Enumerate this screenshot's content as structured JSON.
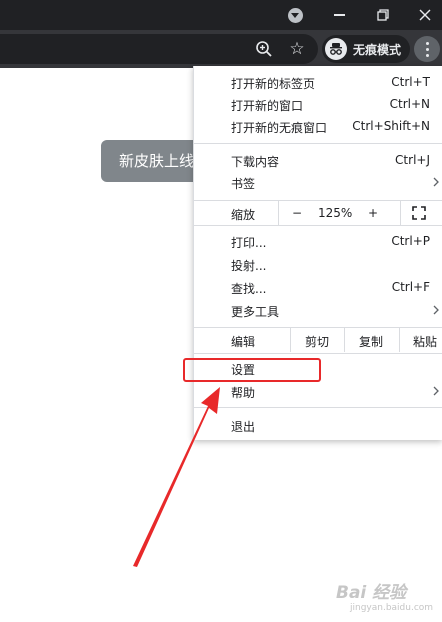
{
  "browser": {
    "incognito_label": "无痕模式"
  },
  "page": {
    "toast_text": "新皮肤上线"
  },
  "menu": {
    "items_top": [
      {
        "label": "打开新的标签页",
        "shortcut": "Ctrl+T"
      },
      {
        "label": "打开新的窗口",
        "shortcut": "Ctrl+N"
      },
      {
        "label": "打开新的无痕窗口",
        "shortcut": "Ctrl+Shift+N"
      }
    ],
    "items_downloads": [
      {
        "label": "下载内容",
        "shortcut": "Ctrl+J"
      },
      {
        "label": "书签",
        "shortcut": ""
      }
    ],
    "zoom": {
      "label": "缩放",
      "minus": "−",
      "value": "125%",
      "plus": "+"
    },
    "items_tools": [
      {
        "label": "打印...",
        "shortcut": "Ctrl+P"
      },
      {
        "label": "投射...",
        "shortcut": ""
      },
      {
        "label": "查找...",
        "shortcut": "Ctrl+F"
      },
      {
        "label": "更多工具",
        "shortcut": ""
      }
    ],
    "edit": {
      "label": "编辑",
      "cut": "剪切",
      "copy": "复制",
      "paste": "粘贴"
    },
    "items_settings": [
      {
        "label": "设置",
        "shortcut": ""
      },
      {
        "label": "帮助",
        "shortcut": ""
      }
    ],
    "exit_label": "退出"
  },
  "colors": {
    "titlebar": "#202124",
    "toolbar": "#35363a",
    "annotation": "#e8292a"
  },
  "watermark": {
    "top": "Bai 经验",
    "bottom": "jingyan.baidu.com"
  }
}
